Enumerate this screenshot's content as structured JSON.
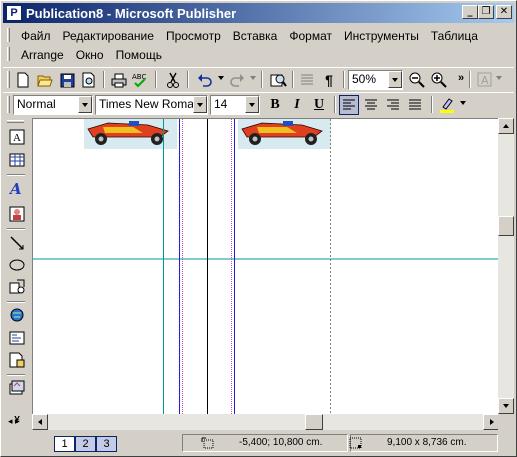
{
  "window": {
    "title": "Publication8 - Microsoft Publisher",
    "controls": {
      "minimize": "_",
      "restore": "❐",
      "close": "✕"
    }
  },
  "menu": {
    "row1": [
      "Файл",
      "Редактирование",
      "Просмотр",
      "Вставка",
      "Формат",
      "Инструменты",
      "Таблица"
    ],
    "row2": [
      "Arrange",
      "Окно",
      "Помощь"
    ]
  },
  "standard_toolbar": {
    "zoom_value": "50%",
    "icons": [
      "new-icon",
      "open-icon",
      "save-icon",
      "print-preview-icon",
      "print-icon",
      "spelling-icon",
      "cut-icon",
      "undo-icon",
      "redo-icon",
      "find-icon",
      "columns-icon",
      "pilcrow-icon",
      "zoom-out-icon",
      "zoom-in-icon",
      "more-icon",
      "format-painter-icon"
    ]
  },
  "format_toolbar": {
    "style_value": "Normal",
    "font_value": "Times New Roman",
    "size_value": "14",
    "bold": "B",
    "italic": "I",
    "underline": "U",
    "more": "»",
    "colors": {
      "highlight": "#ffff00",
      "active_border": "#0a246a"
    }
  },
  "objects_toolbar": {
    "icons": [
      "select-text-icon",
      "table-frame-icon",
      "wordart-icon",
      "picture-frame-icon",
      "line-icon",
      "oval-icon",
      "custom-shapes-icon",
      "hot-spot-icon",
      "form-control-icon",
      "html-fragment-icon",
      "design-gallery-icon",
      "more-icon"
    ]
  },
  "status": {
    "pages": [
      "1",
      "2",
      "3"
    ],
    "active_page": "1",
    "position": "-5,400; 10,800 cm.",
    "size": "9,100 x  8,736 cm."
  },
  "colors": {
    "title_start": "#0a246a",
    "title_end": "#a6caf0",
    "guide_teal": "#009999",
    "guide_blue": "#2020cc",
    "guide_magenta": "#cc44cc"
  }
}
